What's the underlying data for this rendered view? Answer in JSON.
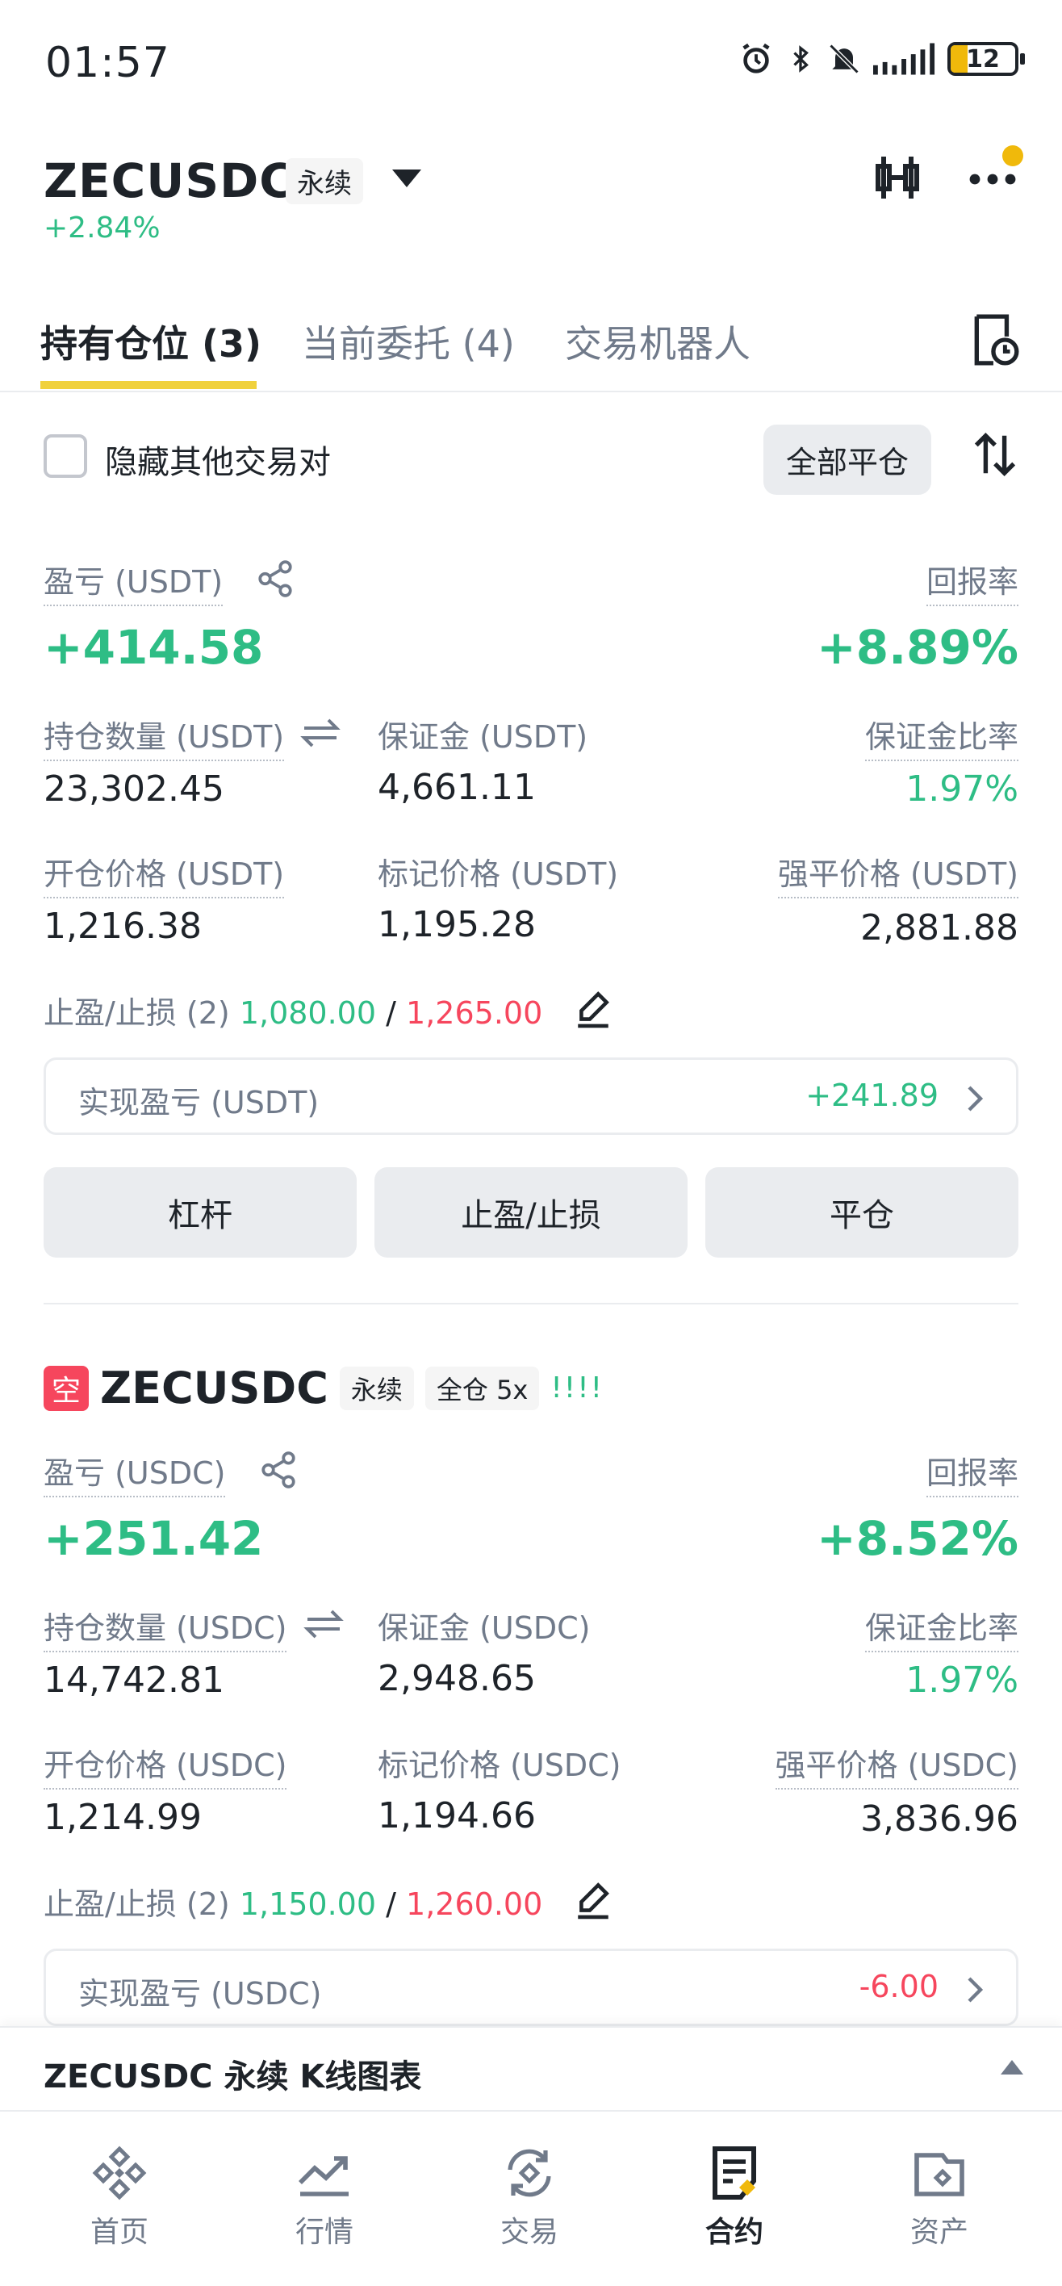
{
  "status_bar": {
    "time": "01:57",
    "battery": "12"
  },
  "header": {
    "pair": "ZECUSDC",
    "contract_type": "永续",
    "change": "+2.84%"
  },
  "tabs": [
    {
      "label": "持有仓位 (3)",
      "active": true
    },
    {
      "label": "当前委托 (4)",
      "active": false
    },
    {
      "label": "交易机器人",
      "active": false
    }
  ],
  "filter": {
    "hide_others_label": "隐藏其他交易对",
    "close_all_label": "全部平仓"
  },
  "positions": [
    {
      "pnl_label": "盈亏 (USDT)",
      "pnl_value": "+414.58",
      "roe_label": "回报率",
      "roe_value": "+8.89%",
      "size_label": "持仓数量 (USDT)",
      "size_value": "23,302.45",
      "margin_label": "保证金 (USDT)",
      "margin_value": "4,661.11",
      "margin_ratio_label": "保证金比率",
      "margin_ratio_value": "1.97%",
      "entry_label": "开仓价格 (USDT)",
      "entry_value": "1,216.38",
      "mark_label": "标记价格 (USDT)",
      "mark_value": "1,195.28",
      "liq_label": "强平价格 (USDT)",
      "liq_value": "2,881.88",
      "tpsl_label": "止盈/止损 (2)",
      "tp_value": "1,080.00",
      "sl_value": "1,265.00",
      "realized_label": "实现盈亏 (USDT)",
      "realized_value": "+241.89",
      "btn_leverage": "杠杆",
      "btn_tpsl": "止盈/止损",
      "btn_close": "平仓"
    },
    {
      "side": "空",
      "pair": "ZECUSDC",
      "contract_type": "永续",
      "margin_mode": "全仓 5x",
      "leverage_bars": "!!!!",
      "pnl_label": "盈亏 (USDC)",
      "pnl_value": "+251.42",
      "roe_label": "回报率",
      "roe_value": "+8.52%",
      "size_label": "持仓数量 (USDC)",
      "size_value": "14,742.81",
      "margin_label": "保证金 (USDC)",
      "margin_value": "2,948.65",
      "margin_ratio_label": "保证金比率",
      "margin_ratio_value": "1.97%",
      "entry_label": "开仓价格 (USDC)",
      "entry_value": "1,214.99",
      "mark_label": "标记价格 (USDC)",
      "mark_value": "1,194.66",
      "liq_label": "强平价格 (USDC)",
      "liq_value": "3,836.96",
      "tpsl_label": "止盈/止损 (2)",
      "tp_value": "1,150.00",
      "sl_value": "1,260.00",
      "realized_label": "实现盈亏 (USDC)",
      "realized_value": "-6.00"
    }
  ],
  "kline_bar": {
    "label": "ZECUSDC 永续 K线图表"
  },
  "bottom_nav": [
    {
      "label": "首页",
      "icon": "home-icon",
      "active": false
    },
    {
      "label": "行情",
      "icon": "markets-icon",
      "active": false
    },
    {
      "label": "交易",
      "icon": "trade-icon",
      "active": false
    },
    {
      "label": "合约",
      "icon": "futures-icon",
      "active": true
    },
    {
      "label": "资产",
      "icon": "wallet-icon",
      "active": false
    }
  ],
  "colors": {
    "green": "#2ebd85",
    "red": "#f6465d",
    "yellow": "#f0b90b",
    "text": "#1e2329",
    "muted": "#707a8a"
  }
}
